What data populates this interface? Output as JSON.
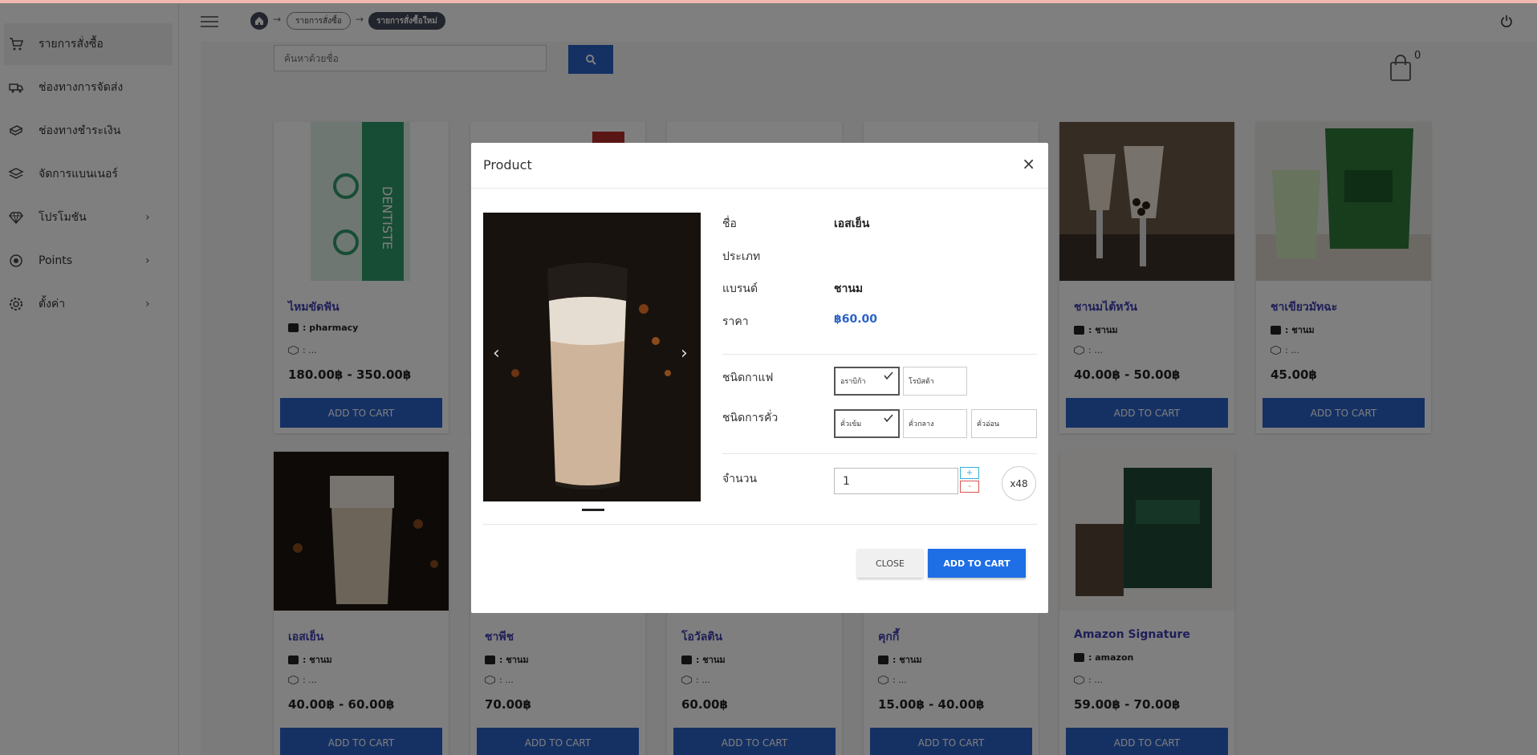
{
  "sidebar": {
    "items": [
      {
        "label": "รายการสั่งซื้อ",
        "icon": "cart-icon",
        "chevron": ""
      },
      {
        "label": "ช่องทางการจัดส่ง",
        "icon": "truck-icon",
        "chevron": ""
      },
      {
        "label": "ช่องทางชำระเงิน",
        "icon": "money-icon",
        "chevron": ""
      },
      {
        "label": "จัดการแบนเนอร์",
        "icon": "layers-icon",
        "chevron": ""
      },
      {
        "label": "โปรโมชัน",
        "icon": "diamond-icon",
        "chevron": "›"
      },
      {
        "label": "Points",
        "icon": "eye-icon",
        "chevron": "›"
      },
      {
        "label": "ตั้งค่า",
        "icon": "gear-icon",
        "chevron": "›"
      }
    ]
  },
  "breadcrumb": {
    "items": [
      "รายการสั่งซื้อ",
      "รายการสั่งซื้อใหม่"
    ],
    "separator": "→"
  },
  "search": {
    "placeholder": "ค้นหาด้วยชื่อ"
  },
  "cart": {
    "count": "0"
  },
  "products": [
    {
      "name": "ไหมขัดฟัน",
      "brand": ": pharmacy",
      "cat": ": ...",
      "price": "180.00฿ - 350.00฿",
      "button": "ADD TO CART"
    },
    {
      "name": "",
      "brand": "",
      "cat": "",
      "price": "",
      "button": ""
    },
    {
      "name": "",
      "brand": "",
      "cat": "",
      "price": "",
      "button": ""
    },
    {
      "name": "",
      "brand": "",
      "cat": "",
      "price": "",
      "button": ""
    },
    {
      "name": "ชานมไต้หวัน",
      "brand": ": ชานม",
      "cat": ": ...",
      "price": "40.00฿ - 50.00฿",
      "button": "ADD TO CART"
    },
    {
      "name": "ชาเขียวมัทฉะ",
      "brand": ": ชานม",
      "cat": ": ...",
      "price": "45.00฿",
      "button": "ADD TO CART"
    },
    {
      "name": "เอสเย็น",
      "brand": ": ชานม",
      "cat": ": ...",
      "price": "40.00฿ - 60.00฿",
      "button": "ADD TO CART"
    },
    {
      "name": "ชาพีช",
      "brand": ": ชานม",
      "cat": ": ...",
      "price": "70.00฿",
      "button": "ADD TO CART"
    },
    {
      "name": "โอวัลติน",
      "brand": ": ชานม",
      "cat": ": ...",
      "price": "60.00฿",
      "button": "ADD TO CART"
    },
    {
      "name": "คุกกี้",
      "brand": ": ชานม",
      "cat": ": ...",
      "price": "15.00฿ - 40.00฿",
      "button": "ADD TO CART"
    },
    {
      "name": "Amazon Signature",
      "brand": ": amazon",
      "cat": ": ...",
      "price": "59.00฿ - 70.00฿",
      "button": "ADD TO CART"
    }
  ],
  "modal": {
    "title": "Product",
    "close_x": "×",
    "labels": {
      "name": "ชื่อ",
      "type": "ประเภท",
      "brand": "แบรนด์",
      "price": "ราคา",
      "coffee": "ชนิดกาแฟ",
      "roast": "ชนิดการคั่ว",
      "qty": "จำนวน"
    },
    "values": {
      "name": "เอสเย็น",
      "type": "",
      "brand": "ชานม",
      "price": "฿60.00"
    },
    "coffee_options": [
      "อราบิก้า",
      "โรบัสต้า"
    ],
    "coffee_selected": "อราบิก้า",
    "roast_options": [
      "คั่วเข้ม",
      "คั่วกลาง",
      "คั่วอ่อน"
    ],
    "roast_selected": "คั่วเข้ม",
    "quantity": "1",
    "plus": "+",
    "minus": "-",
    "stock": "x48",
    "prev": "‹",
    "next": "›",
    "close_button": "CLOSE",
    "add_button": "ADD TO CART"
  },
  "colors": {
    "primary": "#2a62c8",
    "accent": "#1e6ee6",
    "product_name": "#3f3fb0",
    "breadcrumb_active": "#444b5a"
  }
}
